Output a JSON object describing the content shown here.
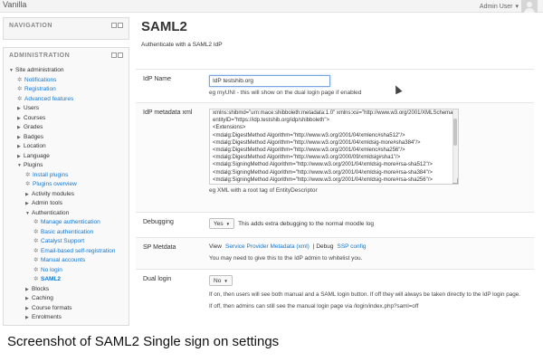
{
  "topbar": {
    "brand": "Vanilla",
    "user_name": "Admin User",
    "user_menu_caret": "▾",
    "avatar_icon": "user-avatar-icon"
  },
  "navigation": {
    "title": "NAVIGATION"
  },
  "administration": {
    "title": "ADMINISTRATION",
    "tree": [
      {
        "label": "Site administration",
        "level": 0,
        "icon": "arrow",
        "expanded": true,
        "style": "plain"
      },
      {
        "label": "Notifications",
        "level": 1,
        "icon": "cog",
        "style": "link"
      },
      {
        "label": "Registration",
        "level": 1,
        "icon": "cog",
        "style": "link"
      },
      {
        "label": "Advanced features",
        "level": 1,
        "icon": "cog",
        "style": "link"
      },
      {
        "label": "Users",
        "level": 1,
        "icon": "arrow",
        "expanded": false,
        "style": "plain"
      },
      {
        "label": "Courses",
        "level": 1,
        "icon": "arrow",
        "expanded": false,
        "style": "plain"
      },
      {
        "label": "Grades",
        "level": 1,
        "icon": "arrow",
        "expanded": false,
        "style": "plain"
      },
      {
        "label": "Badges",
        "level": 1,
        "icon": "arrow",
        "expanded": false,
        "style": "plain"
      },
      {
        "label": "Location",
        "level": 1,
        "icon": "arrow",
        "expanded": false,
        "style": "plain"
      },
      {
        "label": "Language",
        "level": 1,
        "icon": "arrow",
        "expanded": false,
        "style": "plain"
      },
      {
        "label": "Plugins",
        "level": 1,
        "icon": "arrow",
        "expanded": true,
        "style": "plain"
      },
      {
        "label": "Install plugins",
        "level": 2,
        "icon": "cog",
        "style": "link"
      },
      {
        "label": "Plugins overview",
        "level": 2,
        "icon": "cog",
        "style": "link"
      },
      {
        "label": "Activity modules",
        "level": 2,
        "icon": "arrow",
        "expanded": false,
        "style": "plain"
      },
      {
        "label": "Admin tools",
        "level": 2,
        "icon": "arrow",
        "expanded": false,
        "style": "plain"
      },
      {
        "label": "Authentication",
        "level": 2,
        "icon": "arrow",
        "expanded": true,
        "style": "plain"
      },
      {
        "label": "Manage authentication",
        "level": 3,
        "icon": "cog",
        "style": "link"
      },
      {
        "label": "Basic authentication",
        "level": 3,
        "icon": "cog",
        "style": "link"
      },
      {
        "label": "Catalyst Support",
        "level": 3,
        "icon": "cog",
        "style": "link"
      },
      {
        "label": "Email-based self-registration",
        "level": 3,
        "icon": "cog",
        "style": "link"
      },
      {
        "label": "Manual accounts",
        "level": 3,
        "icon": "cog",
        "style": "link"
      },
      {
        "label": "No login",
        "level": 3,
        "icon": "cog",
        "style": "link"
      },
      {
        "label": "SAML2",
        "level": 3,
        "icon": "cog",
        "style": "active"
      },
      {
        "label": "Blocks",
        "level": 2,
        "icon": "arrow",
        "expanded": false,
        "style": "plain"
      },
      {
        "label": "Caching",
        "level": 2,
        "icon": "arrow",
        "expanded": false,
        "style": "plain"
      },
      {
        "label": "Course formats",
        "level": 2,
        "icon": "arrow",
        "expanded": false,
        "style": "plain"
      },
      {
        "label": "Enrolments",
        "level": 2,
        "icon": "arrow",
        "expanded": false,
        "style": "plain"
      }
    ]
  },
  "main": {
    "title": "SAML2",
    "subtitle": "Authenticate with a SAML2 IdP",
    "idp_name": {
      "label": "IdP Name",
      "value": "IdP testshib.org",
      "hint": "eg myUNI - this will show on the dual login page if enabled"
    },
    "metadata": {
      "label": "IdP metadata xml",
      "lines": [
        "xmlns:shibmd=\"urn:mace:shibboleth:metadata:1.0\" xmlns:xsi=\"http://www.w3.org/2001/XMLSchema-instance\"",
        "entityID=\"https://idp.testshib.org/idp/shibboleth\">",
        "<Extensions>",
        "<mdalg:DigestMethod Algorithm=\"http://www.w3.org/2001/04/xmlenc#sha512\"/>",
        "<mdalg:DigestMethod Algorithm=\"http://www.w3.org/2001/04/xmldsig-more#sha384\"/>",
        "<mdalg:DigestMethod Algorithm=\"http://www.w3.org/2001/04/xmlenc#sha256\"/>",
        "<mdalg:DigestMethod Algorithm=\"http://www.w3.org/2000/09/xmldsig#sha1\"/>",
        "<mdalg:SigningMethod Algorithm=\"http://www.w3.org/2001/04/xmldsig-more#rsa-sha512\"/>",
        "<mdalg:SigningMethod Algorithm=\"http://www.w3.org/2001/04/xmldsig-more#rsa-sha384\"/>",
        "<mdalg:SigningMethod Algorithm=\"http://www.w3.org/2001/04/xmldsig-more#rsa-sha256\"/>",
        "<mdalg:SigningMethod Algorithm=\"http://www.w3.org/2000/09/xmldsig#rsa-sha1\"/>"
      ],
      "hint": "eg XML with a root tag of EntityDescriptor"
    },
    "debugging": {
      "label": "Debugging",
      "value": "Yes",
      "caret": "▼",
      "hint": "This adds extra debugging to the normal moodle log"
    },
    "sp_metadata": {
      "label": "SP Metdata",
      "prefix": "View",
      "link1": "Service Provider Metadata (xml)",
      "separator": "| Debug",
      "link2": "SSP config",
      "hint": "You may need to give this to the IdP admin to whitelist you."
    },
    "dual_login": {
      "label": "Dual login",
      "value": "No",
      "caret": "▼",
      "hint1": "If on, then users will see both manual and a SAML login button. If off they will always be taken directly to the IdP login page.",
      "hint2": "If off, then admins can still see the manual login page via /login/index.php?saml=off"
    }
  },
  "caption": "Screenshot of SAML2 Single sign on settings"
}
